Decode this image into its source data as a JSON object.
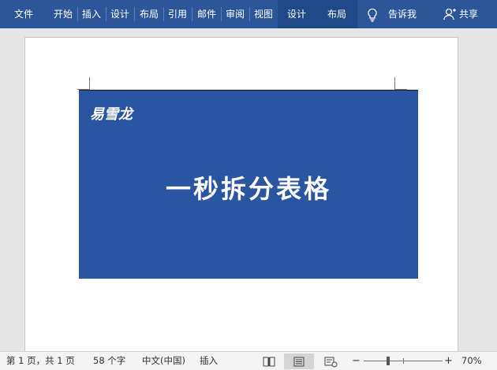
{
  "ribbon": {
    "tabs": [
      "文件",
      "开始",
      "插入",
      "设计",
      "布局",
      "引用",
      "邮件",
      "审阅",
      "视图"
    ],
    "context_tabs": [
      "设计",
      "布局"
    ],
    "tell_me": "告诉我",
    "share": "共享",
    "icons": {
      "tell_me": "lightbulb-icon",
      "share": "person-icon"
    }
  },
  "document": {
    "logo": "易雪龙",
    "title": "一秒拆分表格"
  },
  "status": {
    "page": "第 1 页，共 1 页",
    "words": "58 个字",
    "language": "中文(中国)",
    "mode": "插入",
    "zoom_minus": "−",
    "zoom_plus": "+",
    "zoom": "70%",
    "zoom_level": 0.7,
    "icons": [
      "read-mode-icon",
      "print-layout-icon",
      "web-layout-icon"
    ]
  },
  "colors": {
    "ribbon": "#2b579a",
    "banner": "#2a55a0",
    "status_bar": "#f3f3f3"
  }
}
